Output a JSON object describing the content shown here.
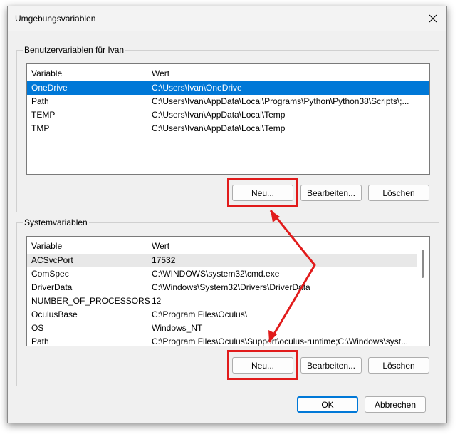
{
  "window": {
    "title": "Umgebungsvariablen"
  },
  "user_vars": {
    "legend": "Benutzervariablen für Ivan",
    "col_variable": "Variable",
    "col_value": "Wert",
    "rows": [
      {
        "name": "OneDrive",
        "value": "C:\\Users\\Ivan\\OneDrive"
      },
      {
        "name": "Path",
        "value": "C:\\Users\\Ivan\\AppData\\Local\\Programs\\Python\\Python38\\Scripts\\;..."
      },
      {
        "name": "TEMP",
        "value": "C:\\Users\\Ivan\\AppData\\Local\\Temp"
      },
      {
        "name": "TMP",
        "value": "C:\\Users\\Ivan\\AppData\\Local\\Temp"
      }
    ],
    "btn_new": "Neu...",
    "btn_edit": "Bearbeiten...",
    "btn_delete": "Löschen"
  },
  "system_vars": {
    "legend": "Systemvariablen",
    "col_variable": "Variable",
    "col_value": "Wert",
    "rows": [
      {
        "name": "ACSvcPort",
        "value": "17532"
      },
      {
        "name": "ComSpec",
        "value": "C:\\WINDOWS\\system32\\cmd.exe"
      },
      {
        "name": "DriverData",
        "value": "C:\\Windows\\System32\\Drivers\\DriverData"
      },
      {
        "name": "NUMBER_OF_PROCESSORS",
        "value": "12"
      },
      {
        "name": "OculusBase",
        "value": "C:\\Program Files\\Oculus\\"
      },
      {
        "name": "OS",
        "value": "Windows_NT"
      },
      {
        "name": "Path",
        "value": "C:\\Program Files\\Oculus\\Support\\oculus-runtime;C:\\Windows\\syst..."
      }
    ],
    "btn_new": "Neu...",
    "btn_edit": "Bearbeiten...",
    "btn_delete": "Löschen"
  },
  "footer": {
    "ok": "OK",
    "cancel": "Abbrechen"
  },
  "icons": {
    "close": "close-icon"
  },
  "colors": {
    "selection": "#0078d7",
    "highlight": "#e11b1b"
  }
}
